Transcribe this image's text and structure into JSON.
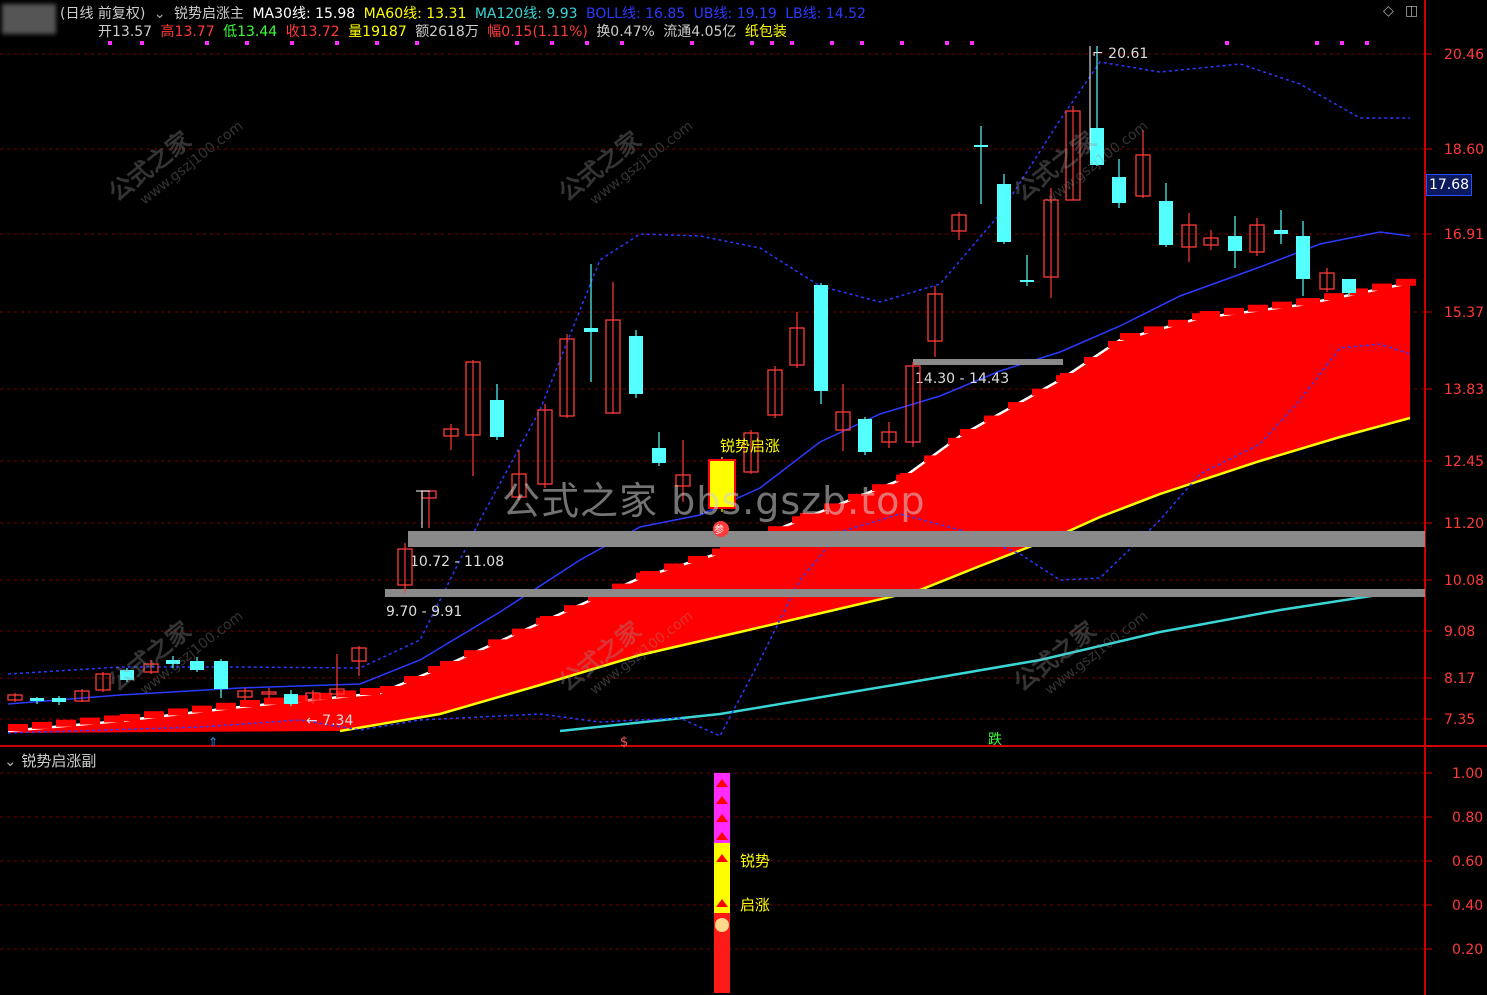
{
  "header": {
    "period": "(日线 前复权)",
    "indicator_main": "锐势启涨主",
    "ma30": "MA30线: 15.98",
    "ma60": "MA60线: 13.31",
    "ma120": "MA120线: 9.93",
    "boll": "BOLL线: 16.85",
    "ub": "UB线: 19.19",
    "lb": "LB线: 14.52",
    "open": "开13.57",
    "high": "高13.77",
    "low": "低13.44",
    "close": "收13.72",
    "volume": "量19187",
    "amount": "额2618万",
    "change": "幅0.15(1.11%)",
    "turnover": "换0.47%",
    "float": "流通4.05亿",
    "sector": "纸包装"
  },
  "colors": {
    "up": "#ff3a3a",
    "down": "#54ffff",
    "ma30": "#ffffff",
    "ma60": "#ffff00",
    "ma120": "#3ad6d6",
    "boll": "#2a3aff",
    "band": "#ff0000",
    "grid": "#7a0000",
    "axis": "#cc0000"
  },
  "price_axis": [
    "20.46",
    "18.60",
    "16.91",
    "15.37",
    "13.83",
    "12.45",
    "11.20",
    "10.08",
    "9.08",
    "8.17",
    "7.35"
  ],
  "current_price": "17.68",
  "sub_axis": [
    "1.00",
    "0.80",
    "0.60",
    "0.40",
    "0.20"
  ],
  "sub_title": "锐势启涨副",
  "annotations": {
    "high_mark": "20.61",
    "low_mark": "7.34",
    "zone1": "10.72 - 11.08",
    "zone2": "9.70 - 9.91",
    "zone3": "14.30 - 14.43",
    "signal": "锐势启涨",
    "sub_label1": "锐势",
    "sub_label2": "启涨",
    "fall_mark": "跌",
    "dollar_mark": "$"
  },
  "watermark_center": "公式之家 bbs.gszb.top",
  "diag_watermark": "公式之家",
  "diag_watermark_url": "www.gszj100.com"
}
